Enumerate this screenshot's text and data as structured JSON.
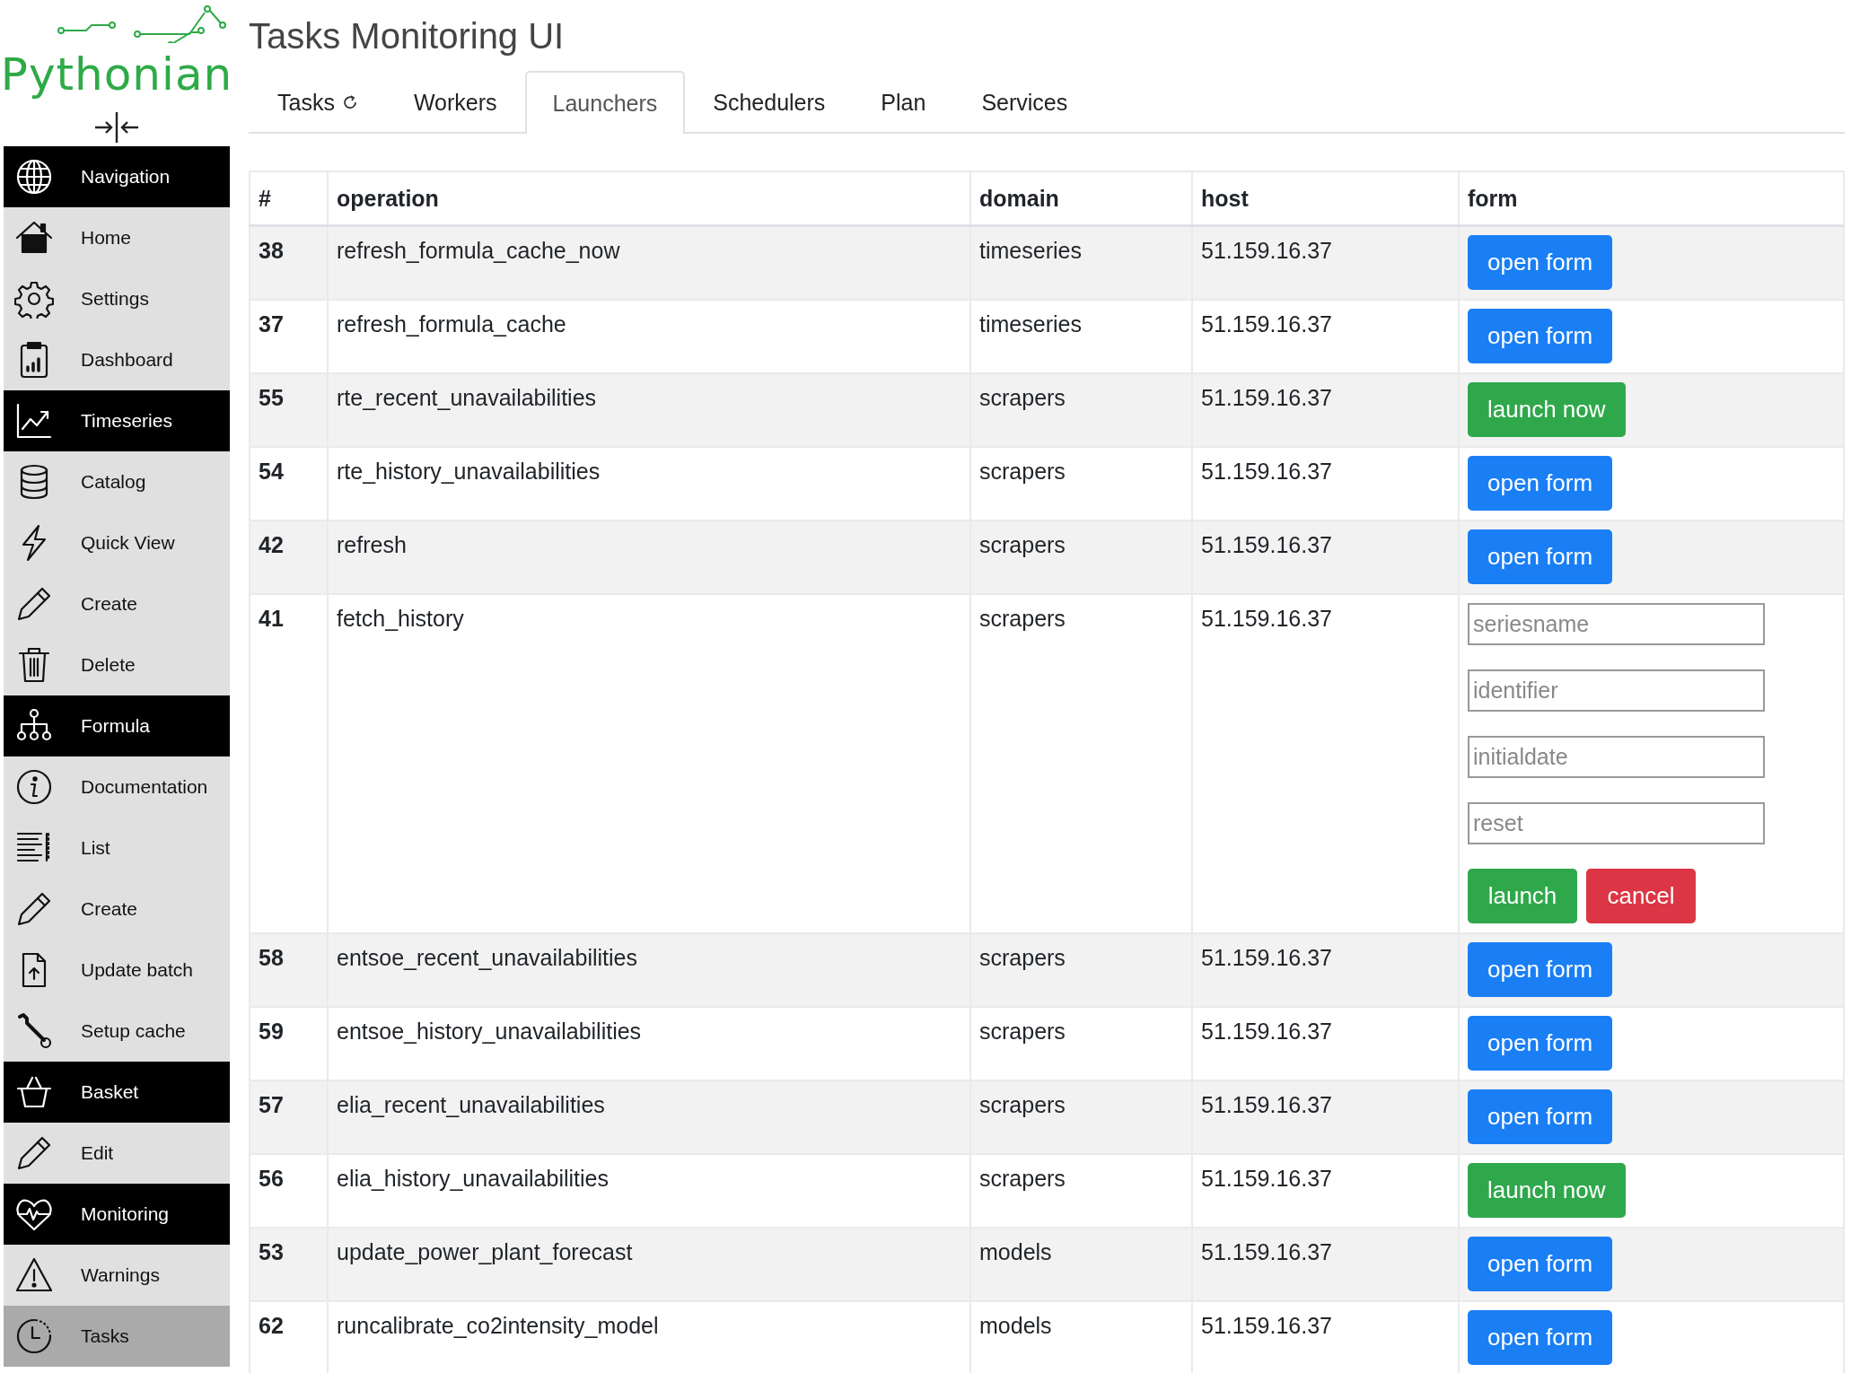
{
  "logo": {
    "text": "Pythonian"
  },
  "sidebar": {
    "items": [
      {
        "label": "Navigation",
        "kind": "section",
        "selected": false
      },
      {
        "label": "Home",
        "kind": "link",
        "selected": false
      },
      {
        "label": "Settings",
        "kind": "link",
        "selected": false
      },
      {
        "label": "Dashboard",
        "kind": "link",
        "selected": false
      },
      {
        "label": "Timeseries",
        "kind": "section",
        "selected": false
      },
      {
        "label": "Catalog",
        "kind": "link",
        "selected": false
      },
      {
        "label": "Quick View",
        "kind": "link",
        "selected": false
      },
      {
        "label": "Create",
        "kind": "link",
        "selected": false
      },
      {
        "label": "Delete",
        "kind": "link",
        "selected": false
      },
      {
        "label": "Formula",
        "kind": "section",
        "selected": false
      },
      {
        "label": "Documentation",
        "kind": "link",
        "selected": false
      },
      {
        "label": "List",
        "kind": "link",
        "selected": false
      },
      {
        "label": "Create",
        "kind": "link",
        "selected": false
      },
      {
        "label": "Update batch",
        "kind": "link",
        "selected": false
      },
      {
        "label": "Setup cache",
        "kind": "link",
        "selected": false
      },
      {
        "label": "Basket",
        "kind": "section",
        "selected": false
      },
      {
        "label": "Edit",
        "kind": "link",
        "selected": false
      },
      {
        "label": "Monitoring",
        "kind": "section",
        "selected": false
      },
      {
        "label": "Warnings",
        "kind": "link",
        "selected": false
      },
      {
        "label": "Tasks",
        "kind": "link",
        "selected": true
      }
    ]
  },
  "page_title": "Tasks Monitoring UI",
  "tabs": [
    {
      "label": "Tasks",
      "selected": false,
      "kind": "refreshable"
    },
    {
      "label": "Workers",
      "selected": false,
      "kind": "plain"
    },
    {
      "label": "Launchers",
      "selected": true,
      "kind": "plain"
    },
    {
      "label": "Schedulers",
      "selected": false,
      "kind": "plain"
    },
    {
      "label": "Plan",
      "selected": false,
      "kind": "plain"
    },
    {
      "label": "Services",
      "selected": false,
      "kind": "plain"
    }
  ],
  "table": {
    "columns": [
      "#",
      "operation",
      "domain",
      "host",
      "form"
    ],
    "rows": [
      {
        "id": "38",
        "operation": "refresh_formula_cache_now",
        "domain": "timeseries",
        "host": "51.159.16.37",
        "form": {
          "kind": "open_button",
          "label": "open form"
        }
      },
      {
        "id": "37",
        "operation": "refresh_formula_cache",
        "domain": "timeseries",
        "host": "51.159.16.37",
        "form": {
          "kind": "open_button",
          "label": "open form"
        }
      },
      {
        "id": "55",
        "operation": "rte_recent_unavailabilities",
        "domain": "scrapers",
        "host": "51.159.16.37",
        "form": {
          "kind": "launch_button",
          "label": "launch now"
        }
      },
      {
        "id": "54",
        "operation": "rte_history_unavailabilities",
        "domain": "scrapers",
        "host": "51.159.16.37",
        "form": {
          "kind": "open_button",
          "label": "open form"
        }
      },
      {
        "id": "42",
        "operation": "refresh",
        "domain": "scrapers",
        "host": "51.159.16.37",
        "form": {
          "kind": "open_button",
          "label": "open form"
        }
      },
      {
        "id": "41",
        "operation": "fetch_history",
        "domain": "scrapers",
        "host": "51.159.16.37",
        "form": {
          "kind": "fields",
          "fields": [
            {
              "placeholder": "seriesname"
            },
            {
              "placeholder": "identifier"
            },
            {
              "placeholder": "initialdate"
            },
            {
              "placeholder": "reset"
            }
          ],
          "buttons": [
            {
              "label": "launch",
              "kind": "confirm"
            },
            {
              "label": "cancel",
              "kind": "cancel"
            }
          ]
        }
      },
      {
        "id": "58",
        "operation": "entsoe_recent_unavailabilities",
        "domain": "scrapers",
        "host": "51.159.16.37",
        "form": {
          "kind": "open_button",
          "label": "open form"
        }
      },
      {
        "id": "59",
        "operation": "entsoe_history_unavailabilities",
        "domain": "scrapers",
        "host": "51.159.16.37",
        "form": {
          "kind": "open_button",
          "label": "open form"
        }
      },
      {
        "id": "57",
        "operation": "elia_recent_unavailabilities",
        "domain": "scrapers",
        "host": "51.159.16.37",
        "form": {
          "kind": "open_button",
          "label": "open form"
        }
      },
      {
        "id": "56",
        "operation": "elia_history_unavailabilities",
        "domain": "scrapers",
        "host": "51.159.16.37",
        "form": {
          "kind": "launch_button",
          "label": "launch now"
        }
      },
      {
        "id": "53",
        "operation": "update_power_plant_forecast",
        "domain": "models",
        "host": "51.159.16.37",
        "form": {
          "kind": "open_button",
          "label": "open form"
        }
      },
      {
        "id": "62",
        "operation": "runcalibrate_co2intensity_model",
        "domain": "models",
        "host": "51.159.16.37",
        "form": {
          "kind": "open_button",
          "label": "open form"
        }
      }
    ]
  }
}
